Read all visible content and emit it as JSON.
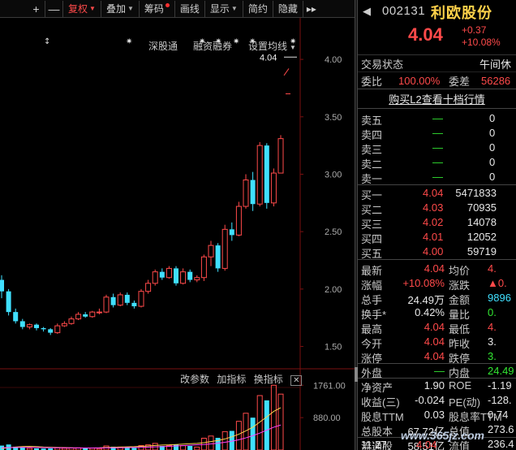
{
  "toolbar": {
    "plus": "+",
    "minus": "—",
    "fuquan": "复权",
    "diejia": "叠加",
    "chouma": "筹码",
    "huaxian": "画线",
    "xianshi": "显示",
    "jianyue": "简约",
    "yincang": "隐藏",
    "more": "▸▸"
  },
  "subtabs": {
    "shengutong": "深股通",
    "rongzi": "融资融券",
    "shezhi": "设置均线"
  },
  "indicator_tabs": {
    "gaicanshu": "改参数",
    "jiazhibiao": "加指标",
    "huanzhibiao": "换指标",
    "close": "✕"
  },
  "chart_data": {
    "type": "candlestick",
    "y_ticks": [
      "4.00",
      "3.50",
      "3.00",
      "2.50",
      "2.00",
      "1.50"
    ],
    "y_range": [
      1.32,
      4.22
    ],
    "high_label": "4.04",
    "volume_ticks": [
      "1761.00",
      "880.00"
    ],
    "volume_range": [
      0,
      1900
    ],
    "candles": [
      {
        "o": 2.08,
        "c": 1.98,
        "h": 2.12,
        "l": 1.92,
        "v": 120
      },
      {
        "o": 1.98,
        "c": 1.8,
        "h": 2.0,
        "l": 1.77,
        "v": 150
      },
      {
        "o": 1.8,
        "c": 1.72,
        "h": 1.83,
        "l": 1.7,
        "v": 90
      },
      {
        "o": 1.72,
        "c": 1.67,
        "h": 1.74,
        "l": 1.65,
        "v": 70
      },
      {
        "o": 1.67,
        "c": 1.69,
        "h": 1.7,
        "l": 1.65,
        "v": 50
      },
      {
        "o": 1.69,
        "c": 1.66,
        "h": 1.7,
        "l": 1.64,
        "v": 45
      },
      {
        "o": 1.66,
        "c": 1.65,
        "h": 1.67,
        "l": 1.63,
        "v": 40
      },
      {
        "o": 1.65,
        "c": 1.62,
        "h": 1.66,
        "l": 1.6,
        "v": 45
      },
      {
        "o": 1.62,
        "c": 1.68,
        "h": 1.7,
        "l": 1.61,
        "v": 60
      },
      {
        "o": 1.68,
        "c": 1.7,
        "h": 1.72,
        "l": 1.67,
        "v": 50
      },
      {
        "o": 1.7,
        "c": 1.74,
        "h": 1.76,
        "l": 1.69,
        "v": 55
      },
      {
        "o": 1.74,
        "c": 1.78,
        "h": 1.8,
        "l": 1.73,
        "v": 60
      },
      {
        "o": 1.78,
        "c": 1.76,
        "h": 1.8,
        "l": 1.75,
        "v": 45
      },
      {
        "o": 1.76,
        "c": 1.8,
        "h": 1.81,
        "l": 1.75,
        "v": 50
      },
      {
        "o": 1.8,
        "c": 1.8,
        "h": 1.83,
        "l": 1.78,
        "v": 40
      },
      {
        "o": 1.8,
        "c": 1.93,
        "h": 1.95,
        "l": 1.79,
        "v": 110
      },
      {
        "o": 1.93,
        "c": 1.86,
        "h": 1.96,
        "l": 1.84,
        "v": 90
      },
      {
        "o": 1.86,
        "c": 1.95,
        "h": 1.97,
        "l": 1.85,
        "v": 80
      },
      {
        "o": 1.95,
        "c": 1.88,
        "h": 1.97,
        "l": 1.86,
        "v": 70
      },
      {
        "o": 1.88,
        "c": 1.85,
        "h": 1.9,
        "l": 1.83,
        "v": 60
      },
      {
        "o": 1.85,
        "c": 1.98,
        "h": 2.0,
        "l": 1.84,
        "v": 120
      },
      {
        "o": 1.98,
        "c": 2.05,
        "h": 2.08,
        "l": 1.96,
        "v": 140
      },
      {
        "o": 2.05,
        "c": 2.15,
        "h": 2.17,
        "l": 2.03,
        "v": 180
      },
      {
        "o": 2.15,
        "c": 2.1,
        "h": 2.18,
        "l": 2.08,
        "v": 110
      },
      {
        "o": 2.1,
        "c": 2.18,
        "h": 2.2,
        "l": 2.09,
        "v": 120
      },
      {
        "o": 2.18,
        "c": 2.05,
        "h": 2.2,
        "l": 2.03,
        "v": 150
      },
      {
        "o": 2.05,
        "c": 2.15,
        "h": 2.18,
        "l": 2.04,
        "v": 120
      },
      {
        "o": 2.15,
        "c": 2.08,
        "h": 2.17,
        "l": 2.06,
        "v": 110
      },
      {
        "o": 2.08,
        "c": 2.1,
        "h": 2.12,
        "l": 2.06,
        "v": 80
      },
      {
        "o": 2.1,
        "c": 2.28,
        "h": 2.3,
        "l": 2.07,
        "v": 320
      },
      {
        "o": 2.28,
        "c": 2.38,
        "h": 2.42,
        "l": 2.2,
        "v": 380
      },
      {
        "o": 2.38,
        "c": 2.18,
        "h": 2.4,
        "l": 2.15,
        "v": 330
      },
      {
        "o": 2.18,
        "c": 2.52,
        "h": 2.56,
        "l": 2.16,
        "v": 500
      },
      {
        "o": 2.52,
        "c": 2.47,
        "h": 2.58,
        "l": 2.42,
        "v": 520
      },
      {
        "o": 2.47,
        "c": 2.72,
        "h": 2.76,
        "l": 2.46,
        "v": 780
      },
      {
        "o": 2.72,
        "c": 2.95,
        "h": 3.0,
        "l": 2.7,
        "v": 1000
      },
      {
        "o": 2.95,
        "c": 2.74,
        "h": 3.02,
        "l": 2.68,
        "v": 880
      },
      {
        "o": 2.74,
        "c": 3.25,
        "h": 3.28,
        "l": 2.72,
        "v": 1480
      },
      {
        "o": 3.25,
        "c": 2.75,
        "h": 3.27,
        "l": 2.7,
        "v": 1350
      },
      {
        "o": 2.75,
        "c": 3.01,
        "h": 3.05,
        "l": 2.72,
        "v": 1761
      },
      {
        "o": 3.01,
        "c": 3.31,
        "h": 3.34,
        "l": 3.17,
        "v": 1520
      }
    ],
    "ma_yellow": [
      40,
      60,
      80,
      95,
      100,
      90,
      80,
      75,
      70,
      65,
      60,
      55,
      52,
      55,
      60,
      70,
      75,
      80,
      85,
      90,
      100,
      110,
      125,
      135,
      140,
      150,
      160,
      170,
      180,
      200,
      230,
      260,
      300,
      360,
      430,
      520,
      620,
      760,
      900,
      1050,
      1150
    ],
    "ma_magenta": [
      60,
      65,
      70,
      72,
      70,
      68,
      66,
      64,
      62,
      60,
      58,
      56,
      55,
      55,
      56,
      58,
      60,
      62,
      65,
      68,
      72,
      78,
      85,
      92,
      100,
      110,
      120,
      130,
      140,
      150,
      165,
      185,
      210,
      240,
      280,
      330,
      390,
      460,
      540,
      620,
      680
    ]
  },
  "quote": {
    "back_icon": "triangle-left-icon",
    "code": "002131",
    "name": "利欧股份",
    "price": "4.04",
    "change": "+0.37",
    "change_pct": "+10.08%",
    "status_label": "交易状态",
    "status_value": "午间休",
    "weibi_label": "委比",
    "weibi_value": "100.00%",
    "weicha_label": "委差",
    "weicha_value": "56286",
    "l2_link": "购买L2查看十档行情",
    "sells": [
      {
        "label": "卖五",
        "price": "—",
        "vol": "0"
      },
      {
        "label": "卖四",
        "price": "—",
        "vol": "0"
      },
      {
        "label": "卖三",
        "price": "—",
        "vol": "0"
      },
      {
        "label": "卖二",
        "price": "—",
        "vol": "0"
      },
      {
        "label": "卖一",
        "price": "—",
        "vol": "0"
      }
    ],
    "buys": [
      {
        "label": "买一",
        "price": "4.04",
        "vol": "5471833"
      },
      {
        "label": "买二",
        "price": "4.03",
        "vol": "70935"
      },
      {
        "label": "买三",
        "price": "4.02",
        "vol": "14078"
      },
      {
        "label": "买四",
        "price": "4.01",
        "vol": "12052"
      },
      {
        "label": "买五",
        "price": "4.00",
        "vol": "59719"
      }
    ],
    "stats": [
      {
        "l1": "最新",
        "v1": "4.04",
        "c1": "red",
        "l2": "均价",
        "v2": "4.",
        "c2": "red"
      },
      {
        "l1": "涨幅",
        "v1": "+10.08%",
        "c1": "red",
        "l2": "涨跌",
        "v2": "▲0.",
        "c2": "red"
      },
      {
        "l1": "总手",
        "v1": "24.49万",
        "c1": "wht",
        "l2": "金额",
        "v2": "9896",
        "c2": "cyan"
      },
      {
        "l1": "换手*",
        "v1": "0.42%",
        "c1": "wht",
        "l2": "量比",
        "v2": "0.",
        "c2": "grn"
      },
      {
        "l1": "最高",
        "v1": "4.04",
        "c1": "red",
        "l2": "最低",
        "v2": "4.",
        "c2": "red"
      },
      {
        "l1": "今开",
        "v1": "4.04",
        "c1": "red",
        "l2": "昨收",
        "v2": "3.",
        "c2": "wht"
      },
      {
        "l1": "涨停",
        "v1": "4.04",
        "c1": "red",
        "l2": "跌停",
        "v2": "3.",
        "c2": "grn"
      },
      {
        "l1": "外盘",
        "v1": "—",
        "c1": "grn",
        "l2": "内盘",
        "v2": "24.49",
        "c2": "grn"
      },
      {
        "l1": "净资产",
        "v1": "1.90",
        "c1": "wht",
        "l2": "ROE",
        "v2": "-1.19",
        "c2": "wht"
      },
      {
        "l1": "收益(三)",
        "v1": "-0.024",
        "c1": "wht",
        "l2": "PE(动)",
        "v2": "-128.",
        "c2": "wht"
      },
      {
        "l1": "股息TTM",
        "v1": "0.03",
        "c1": "wht",
        "l2": "股息率TTM",
        "v2": "0.74",
        "c2": "wht"
      },
      {
        "l1": "总股本",
        "v1": "67.72亿",
        "c1": "wht",
        "l2": "总值",
        "v2": "273.6",
        "c2": "wht"
      },
      {
        "l1": "流通股",
        "v1": "58.51亿",
        "c1": "wht",
        "l2": "流值",
        "v2": "236.4",
        "c2": "wht"
      }
    ],
    "tick_time": "11:27",
    "tick_price": "4.04"
  },
  "watermark": "www.365jz.com",
  "colors": {
    "up": "#ff4a4a",
    "down": "#40e0ff",
    "ma_yellow": "#ffd24a",
    "ma_magenta": "#ff40ff"
  }
}
